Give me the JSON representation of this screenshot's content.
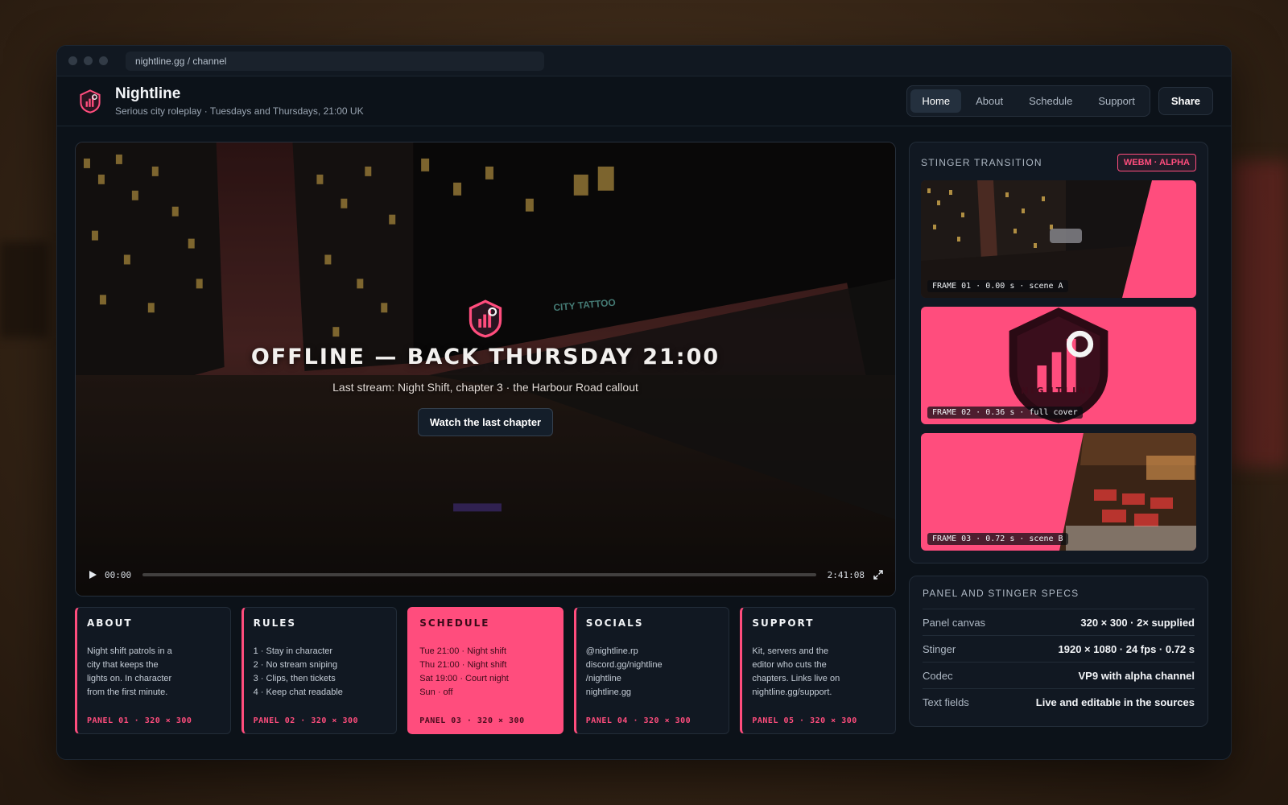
{
  "url": "nightline.gg / channel",
  "brand": {
    "name": "Nightline",
    "tagline": "Serious city roleplay · Tuesdays and Thursdays, 21:00 UK"
  },
  "nav": [
    "Home",
    "About",
    "Schedule",
    "Support"
  ],
  "share_label": "Share",
  "player": {
    "status": "OFFLINE — BACK THURSDAY 21:00",
    "last_stream": "Last stream: Night Shift, chapter 3 · the Harbour Road callout",
    "watch_label": "Watch the last chapter",
    "time_current": "00:00",
    "time_total": "2:41:08",
    "progress": 0
  },
  "panels": [
    {
      "title": "ABOUT",
      "lines": [
        "Night shift patrols in a",
        "city that keeps the",
        "lights on. In character",
        "from the first minute."
      ],
      "code": "PANEL 01 · 320 × 300"
    },
    {
      "title": "RULES",
      "lines": [
        "1 · Stay in character",
        "2 · No stream sniping",
        "3 · Clips, then tickets",
        "4 · Keep chat readable"
      ],
      "code": "PANEL 02 · 320 × 300"
    },
    {
      "title": "SCHEDULE",
      "lines": [
        "Tue 21:00 · Night shift",
        "Thu 21:00 · Night shift",
        "Sat 19:00 · Court night",
        "Sun · off"
      ],
      "code": "PANEL 03 · 320 × 300"
    },
    {
      "title": "SOCIALS",
      "lines": [
        "@nightline.rp",
        "discord.gg/nightline",
        "/nightline",
        "nightline.gg"
      ],
      "code": "PANEL 04 · 320 × 300"
    },
    {
      "title": "SUPPORT",
      "lines": [
        "Kit, servers and the",
        "editor who cuts the",
        "chapters. Links live on",
        "nightline.gg/support."
      ],
      "code": "PANEL 05 · 320 × 300"
    }
  ],
  "stinger": {
    "title": "STINGER TRANSITION",
    "badge": "WEBM · ALPHA",
    "frames": [
      {
        "label": "FRAME 01 · 0.00 s · scene A"
      },
      {
        "label": "FRAME 02 · 0.36 s · full cover",
        "wordmark": "NIGHTLINE"
      },
      {
        "label": "FRAME 03 · 0.72 s · scene B"
      }
    ]
  },
  "specs": {
    "title": "PANEL AND STINGER SPECS",
    "rows": [
      {
        "label": "Panel canvas",
        "value": "320 × 300 · 2× supplied"
      },
      {
        "label": "Stinger",
        "value": "1920 × 1080 · 24 fps · 0.72 s"
      },
      {
        "label": "Codec",
        "value": "VP9 with alpha channel"
      },
      {
        "label": "Text fields",
        "value": "Live and editable in the sources"
      }
    ]
  },
  "colors": {
    "accent": "#ff4d7d",
    "bg": "#0c1219",
    "panel": "#111822"
  },
  "icons": [
    "logo-shield-icon",
    "play-icon",
    "expand-icon"
  ]
}
